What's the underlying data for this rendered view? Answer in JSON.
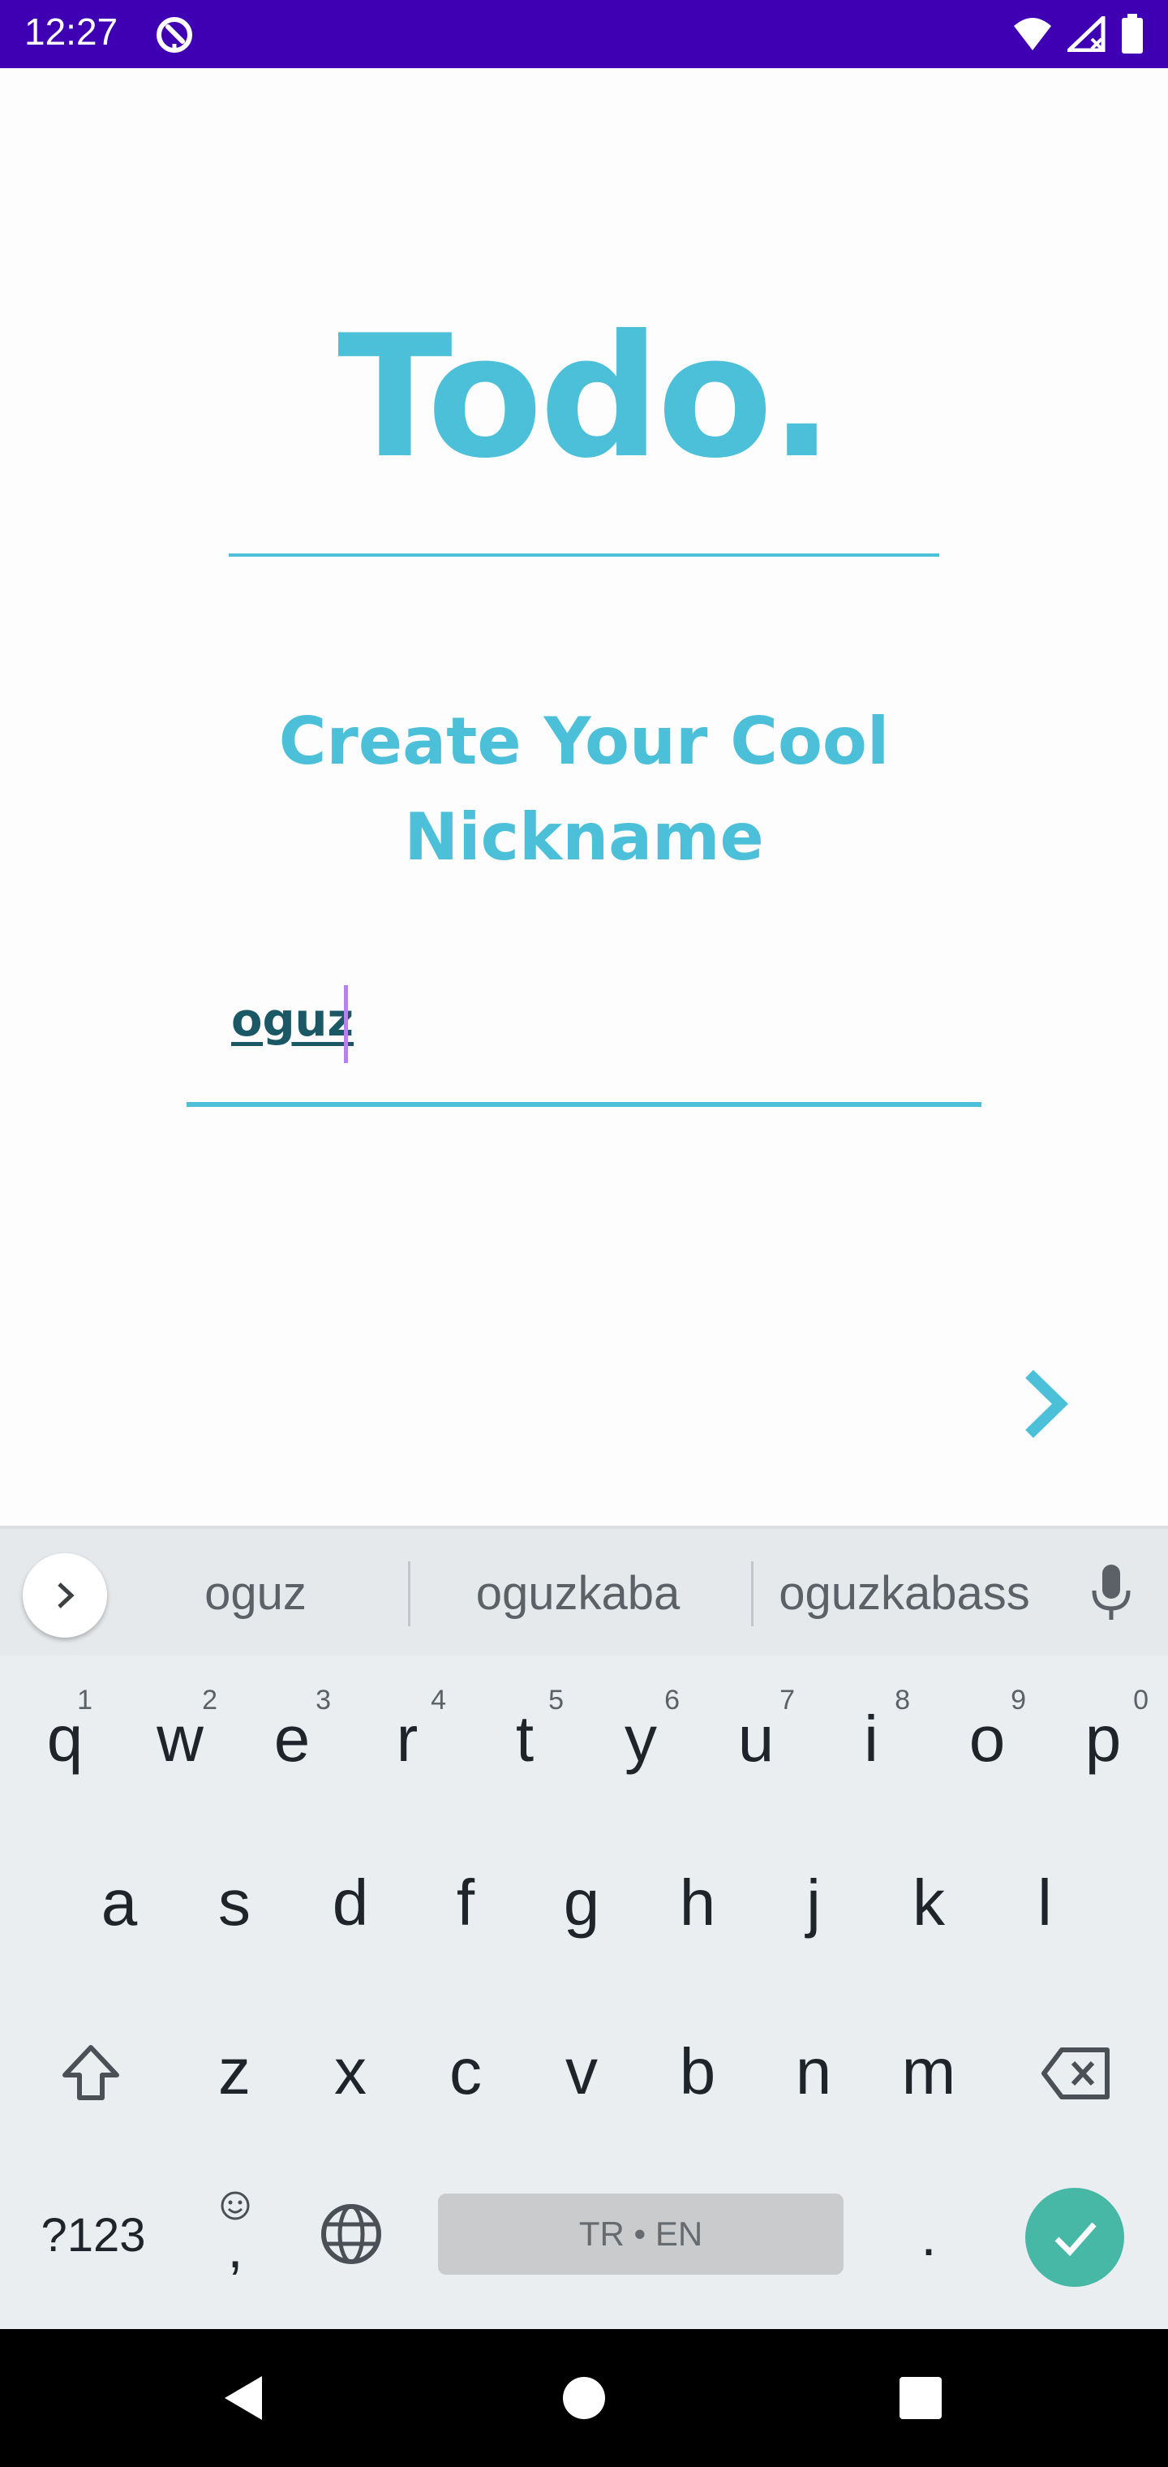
{
  "status_bar": {
    "time": "12:27",
    "icons": [
      "app-notification-icon",
      "wifi-icon",
      "signal-icon",
      "battery-icon"
    ],
    "background": "#3f00b4"
  },
  "app": {
    "title": "Todo.",
    "prompt": "Create Your Cool Nickname",
    "nickname_value": "oguz",
    "accent_color": "#4dc0d9",
    "next_icon": "chevron-right-icon"
  },
  "keyboard": {
    "suggestions": [
      "oguz",
      "oguzkaba",
      "oguzkabass"
    ],
    "row1": [
      {
        "key": "q",
        "hint": "1"
      },
      {
        "key": "w",
        "hint": "2"
      },
      {
        "key": "e",
        "hint": "3"
      },
      {
        "key": "r",
        "hint": "4"
      },
      {
        "key": "t",
        "hint": "5"
      },
      {
        "key": "y",
        "hint": "6"
      },
      {
        "key": "u",
        "hint": "7"
      },
      {
        "key": "i",
        "hint": "8"
      },
      {
        "key": "o",
        "hint": "9"
      },
      {
        "key": "p",
        "hint": "0"
      }
    ],
    "row2": [
      "a",
      "s",
      "d",
      "f",
      "g",
      "h",
      "j",
      "k",
      "l"
    ],
    "row3": [
      "z",
      "x",
      "c",
      "v",
      "b",
      "n",
      "m"
    ],
    "symbols_label": "?123",
    "comma_label": ",",
    "space_label": "TR • EN",
    "period_label": ".",
    "enter_color": "#47b8a6"
  }
}
